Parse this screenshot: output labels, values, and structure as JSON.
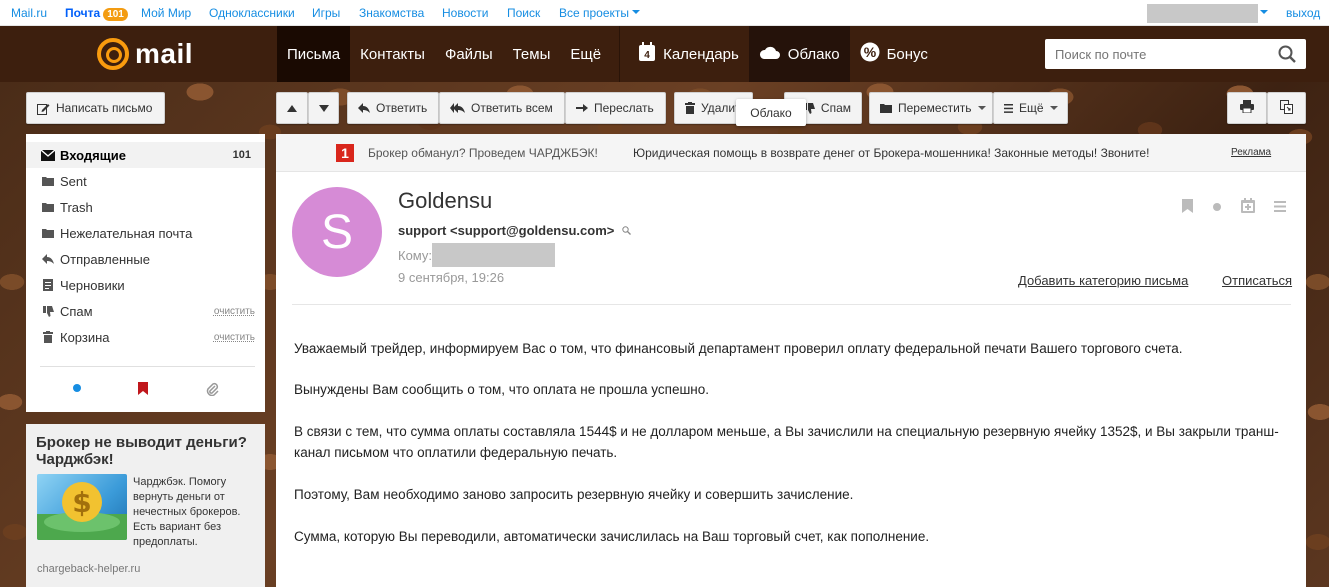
{
  "portal": {
    "links": [
      "Mail.ru",
      "Почта",
      "Мой Мир",
      "Одноклассники",
      "Игры",
      "Знакомства",
      "Новости",
      "Поиск",
      "Все проекты"
    ],
    "mail_badge": "101",
    "logout": "выход"
  },
  "header": {
    "logo_text": "mail",
    "nav": [
      "Письма",
      "Контакты",
      "Файлы",
      "Темы",
      "Ещё"
    ],
    "nav_right": [
      "Календарь",
      "Облако",
      "Бонус"
    ],
    "calendar_day": "4",
    "search_placeholder": "Поиск по почте"
  },
  "toolbar": {
    "compose": "Написать письмо",
    "reply": "Ответить",
    "reply_all": "Ответить всем",
    "forward": "Переслать",
    "delete": "Удалить",
    "spam": "Спам",
    "move": "Переместить",
    "more": "Ещё",
    "tooltip": "Облако"
  },
  "folders": [
    {
      "label": "Входящие",
      "count": "101"
    },
    {
      "label": "Sent"
    },
    {
      "label": "Trash"
    },
    {
      "label": "Нежелательная почта"
    },
    {
      "label": "Отправленные"
    },
    {
      "label": "Черновики"
    },
    {
      "label": "Спам",
      "action": "очистить"
    },
    {
      "label": "Корзина",
      "action": "очистить"
    }
  ],
  "side_ad": {
    "title": "Брокер не выводит деньги? Чарджбэк!",
    "text": "Чарджбэк. Помогу вернуть деньги от нечестных брокеров. Есть вариант без предоплаты.",
    "url": "chargeback-helper.ru"
  },
  "top_ad": {
    "number": "1",
    "text1": "Брокер обманул? Проведем ЧАРДЖБЭК!",
    "text2": "Юридическая помощь в возврате денег от Брокера-мошенника! Законные методы! Звоните!",
    "label": "Реклама"
  },
  "letter": {
    "avatar_letter": "S",
    "subject": "Goldensu",
    "sender": "support <support@goldensu.com>",
    "to_label": "Кому:",
    "date": "9 сентября, 19:26",
    "add_category": "Добавить категорию письма",
    "unsubscribe": "Отписаться",
    "paragraphs": [
      "Уважаемый трейдер, информируем Вас о том, что финансовый департамент проверил оплату федеральной печати Вашего торгового счета.",
      "Вынуждены Вам сообщить о том, что оплата не прошла успешно.",
      "В связи с тем, что сумма оплаты составляла 1544$ и не долларом меньше, а Вы зачислили на специальную резервную ячейку 1352$, и Вы закрыли транш-канал письмом что оплатили федеральную печать.",
      "Поэтому, Вам необходимо заново запросить резервную ячейку и совершить зачисление.",
      "Сумма, которую Вы переводили, автоматически зачислилась на Ваш торговый счет, как пополнение."
    ]
  },
  "colors": {
    "header_bg": "#3d1f0e",
    "accent": "#f99b0e",
    "link": "#168de2",
    "avatar": "#d68bd6"
  }
}
